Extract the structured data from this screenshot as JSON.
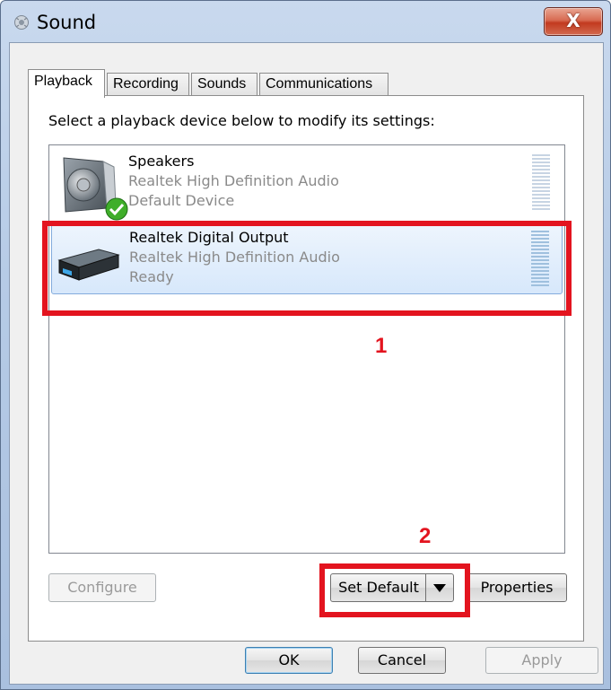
{
  "window": {
    "title": "Sound",
    "close_label": "X"
  },
  "tabs": [
    {
      "label": "Playback",
      "active": true
    },
    {
      "label": "Recording",
      "active": false
    },
    {
      "label": "Sounds",
      "active": false
    },
    {
      "label": "Communications",
      "active": false
    }
  ],
  "playback": {
    "instruction": "Select a playback device below to modify its settings:",
    "devices": [
      {
        "name": "Speakers",
        "driver": "Realtek High Definition Audio",
        "status": "Default Device",
        "icon": "speaker-icon",
        "default": true,
        "selected": false
      },
      {
        "name": "Realtek Digital Output",
        "driver": "Realtek High Definition Audio",
        "status": "Ready",
        "icon": "digital-output-icon",
        "default": false,
        "selected": true
      }
    ]
  },
  "buttons": {
    "configure": "Configure",
    "set_default": "Set Default",
    "properties": "Properties",
    "ok": "OK",
    "cancel": "Cancel",
    "apply": "Apply"
  },
  "annotations": {
    "first": "1",
    "second": "2",
    "color": "#e3141f"
  },
  "colors": {
    "selection": "#d7e8fb",
    "selection_border": "#84acdd",
    "close_red": "#c23a1f"
  }
}
